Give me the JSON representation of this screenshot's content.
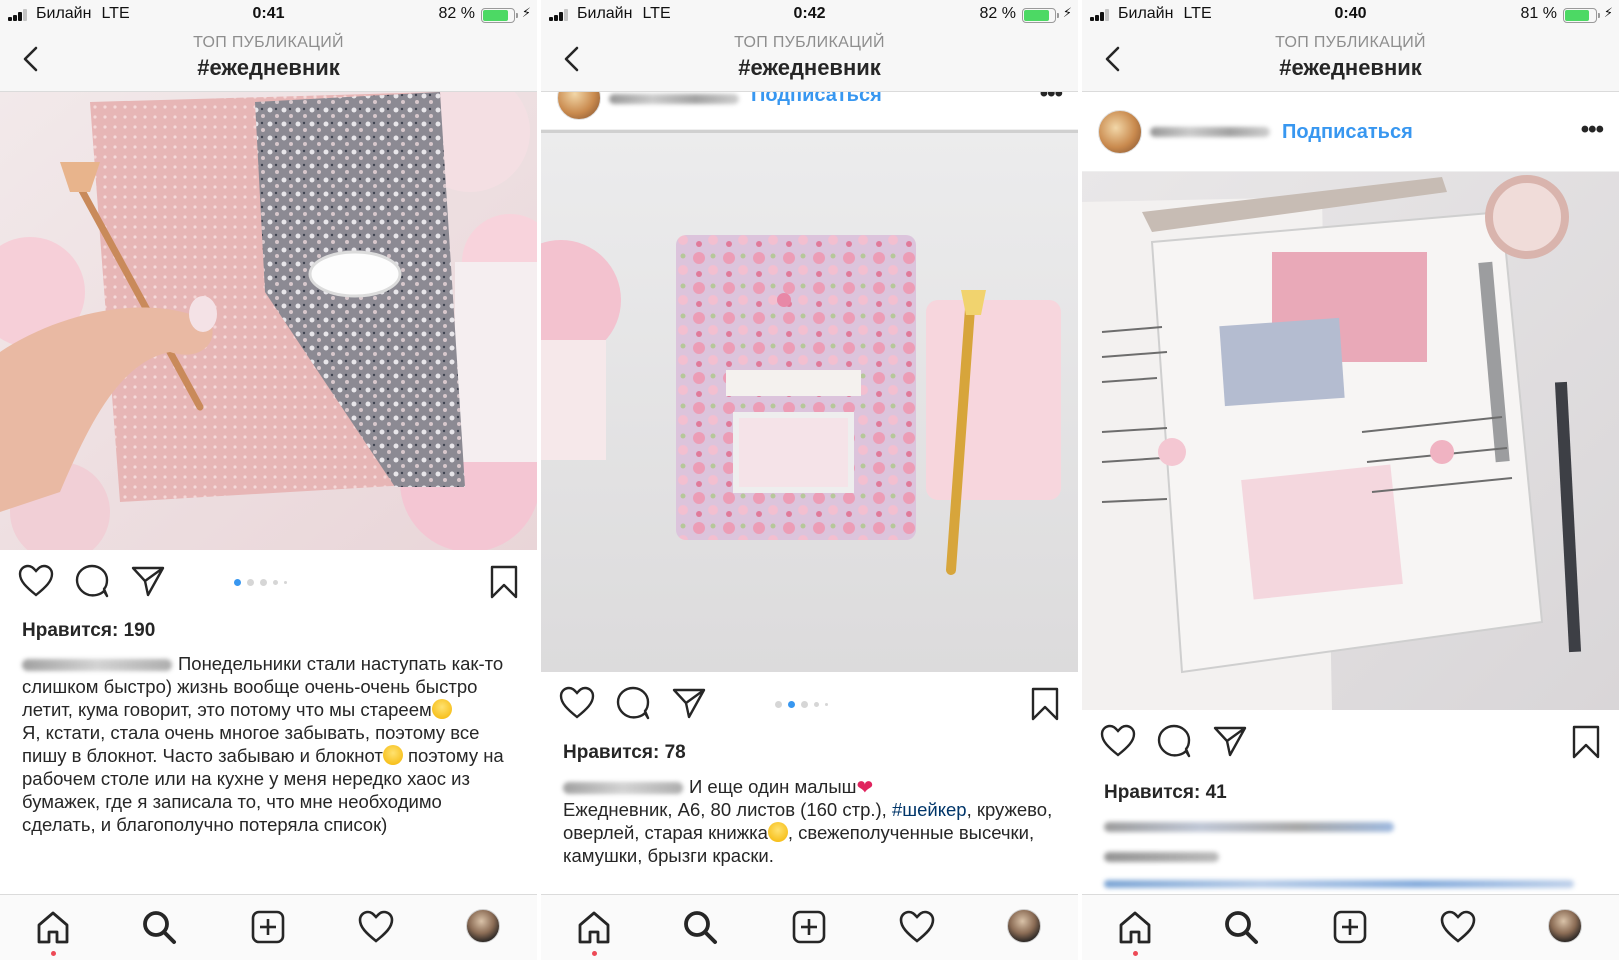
{
  "panels": [
    {
      "status": {
        "carrier": "Билайн",
        "network": "LTE",
        "time": "0:41",
        "battery": "82 %",
        "battery_level": 0.82,
        "charging_glyph": "⚡"
      },
      "header": {
        "title": "ТОП ПУБЛИКАЦИЙ",
        "hashtag": "#ежедневник"
      },
      "post": {
        "photo_icon": "pink-planner-with-floral-flap-and-gold-pen",
        "carousel": {
          "count": 5,
          "active": 1
        },
        "likes": "Нравится: 190",
        "caption": {
          "text": "Понедельники стали наступать как-то слишком быстро) жизнь вообще очень-очень быстро летит, кума говорит, это потому что мы стареем",
          "text2": "Я, кстати, стала очень многое забывать, поэтому все пишу в блокнот. Часто забываю и блокнот",
          "text3": "поэтому на рабочем столе или на кухне у меня нередко хаос из бумажек, где я записала то, что мне необходимо сделать, и благополучно потеряла список)"
        }
      }
    },
    {
      "status": {
        "carrier": "Билайн",
        "network": "LTE",
        "time": "0:42",
        "battery": "82 %",
        "battery_level": 0.82,
        "charging_glyph": "⚡"
      },
      "header": {
        "title": "ТОП ПУБЛИКАЦИЙ",
        "hashtag": "#ежедневник"
      },
      "post": {
        "follow": "Подписаться",
        "menu": "•••",
        "photo_icon": "floral-notebook-with-shaker-window-and-gold-pen",
        "carousel": {
          "count": 5,
          "active": 2
        },
        "likes": "Нравится: 78",
        "caption": {
          "text": "И еще один малыш",
          "text2": "Ежедневник, А6, 80 листов (160 стр.),",
          "hashtag": "#шейкер",
          "text3": ", кружево, оверлей, старая книжка",
          "text4": ", свежеполученные высечки, камушки, брызги краски."
        }
      }
    },
    {
      "status": {
        "carrier": "Билайн",
        "network": "LTE",
        "time": "0:40",
        "battery": "81 %",
        "battery_level": 0.81,
        "charging_glyph": "⚡"
      },
      "header": {
        "title": "ТОП ПУБЛИКАЦИЙ",
        "hashtag": "#ежедневник"
      },
      "post": {
        "follow": "Подписаться",
        "menu": "•••",
        "photo_icon": "open-bullet-journal-spread-with-stickers",
        "likes": "Нравится: 41"
      }
    }
  ],
  "tabbar": {
    "items": [
      "home-icon",
      "search-icon",
      "add-post-icon",
      "activity-heart-icon",
      "profile-avatar"
    ]
  },
  "colors": {
    "accent_blue": "#3897f0",
    "hashtag_blue": "#003569",
    "notification_red": "#ed4956",
    "battery_green": "#4cd964",
    "text": "#262626",
    "muted": "#8e8e8e"
  }
}
